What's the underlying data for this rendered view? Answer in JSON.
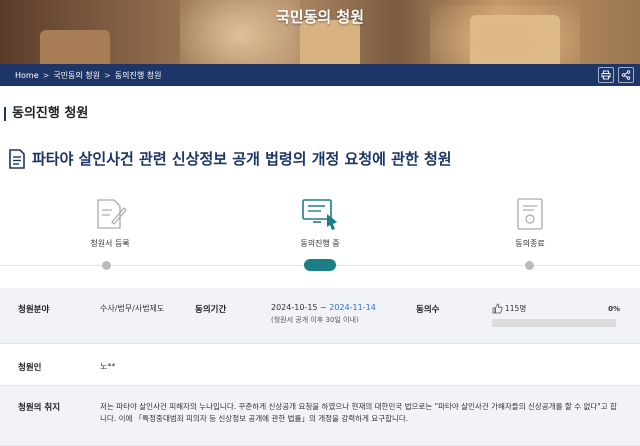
{
  "header": {
    "title": "국민동의 청원"
  },
  "breadcrumb": {
    "items": [
      "Home",
      "국민동의 청원",
      "동의진행 청원"
    ],
    "separator": ">"
  },
  "toolbar": {
    "print_icon": "printer-icon",
    "share_icon": "share-icon"
  },
  "section": {
    "title": "동의진행 청원"
  },
  "petition": {
    "title": "파타야 살인사건 관련 신상정보 공개 법령의 개정 요청에 관한 청원"
  },
  "steps": [
    {
      "label": "청원서 등록",
      "icon": "document-pen-icon"
    },
    {
      "label": "동의진행 중",
      "icon": "monitor-hand-icon",
      "active": true
    },
    {
      "label": "동의종료",
      "icon": "certificate-icon"
    }
  ],
  "info": {
    "field_label": "청원분야",
    "field_value": "수사/법무/사법제도",
    "period_label": "동의기간",
    "period_start": "2024-10-15",
    "period_sep": " ~ ",
    "period_end": "2024-11-14",
    "period_note": "(청원서 공개 이후 30일 이내)",
    "agree_label": "동의수",
    "agree_count": "115명",
    "agree_percent": "0%",
    "agree_progress": 0,
    "petitioner_label": "청원인",
    "petitioner_value": "노**",
    "purpose_label": "청원의 취지",
    "purpose_text": "저는 파타야 살인사건 피해자의 누나입니다. 꾸준하게 신상공개 요청을 하였으나 현재의 대한민국 법으로는 \"파타야 살인사건 가해자들의 신상공개를 할 수 없다\"고 합니다. 이에 「특정중대범죄 피의자 등 신상정보 공개에 관한 법률」의 개정을 강력하게 요구합니다."
  },
  "colors": {
    "navy": "#1d3567",
    "teal": "#1d7f85",
    "blue": "#2f6fd6"
  }
}
